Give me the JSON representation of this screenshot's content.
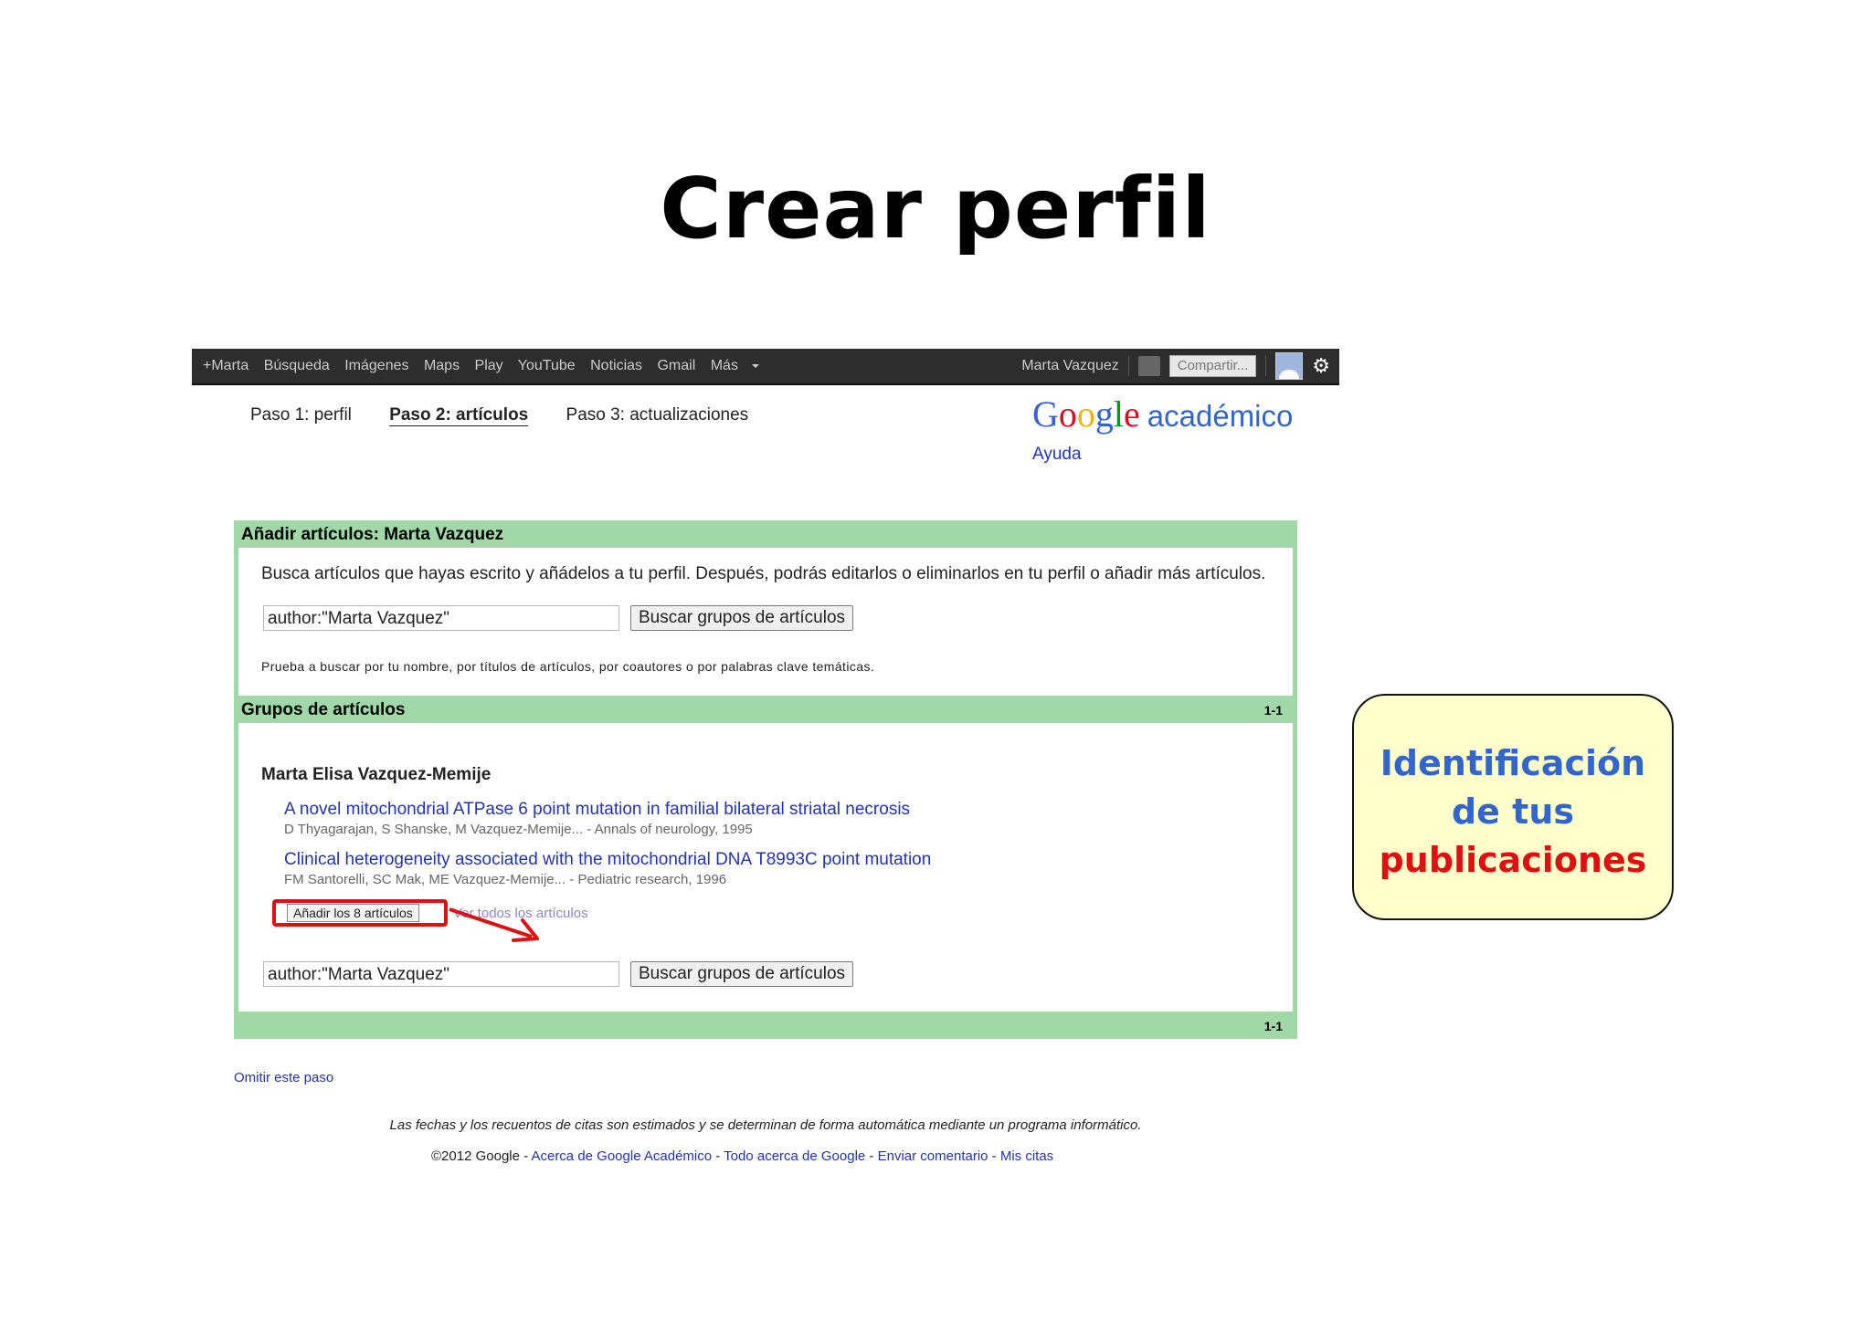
{
  "slide": {
    "title": "Crear perfil"
  },
  "gbar": {
    "links": [
      "+Marta",
      "Búsqueda",
      "Imágenes",
      "Maps",
      "Play",
      "YouTube",
      "Noticias",
      "Gmail",
      "Más"
    ],
    "user_name": "Marta Vazquez",
    "share_label": "Compartir..."
  },
  "steps": {
    "step1": "Paso 1: perfil",
    "step2": "Paso 2: artículos",
    "step3": "Paso 3: actualizaciones"
  },
  "logo": {
    "g": [
      "G",
      "o",
      "o",
      "g",
      "l",
      "e"
    ],
    "suffix": "académico"
  },
  "help_label": "Ayuda",
  "add_section": {
    "heading": "Añadir artículos: Marta Vazquez",
    "description": "Busca artículos que hayas escrito y añádelos a tu perfil. Después, podrás editarlos o eliminarlos en tu perfil o añadir más artículos.",
    "search_value": "author:\"Marta Vazquez\"",
    "search_button": "Buscar grupos de artículos",
    "hint": "Prueba a buscar por tu nombre, por títulos de artículos, por coautores o por palabras clave temáticas."
  },
  "groups_section": {
    "heading": "Grupos de artículos",
    "count": "1-1",
    "author": "Marta Elisa Vazquez-Memije",
    "articles": [
      {
        "title": "A novel mitochondrial ATPase 6 point mutation in familial bilateral striatal necrosis",
        "meta": "D Thyagarajan, S Shanske, M Vazquez-Memije... - Annals of neurology, 1995"
      },
      {
        "title": "Clinical heterogeneity associated with the mitochondrial DNA T8993C point mutation",
        "meta": "FM Santorelli, SC Mak, ME Vazquez-Memije... - Pediatric research, 1996"
      }
    ],
    "add_all_button": "Añadir los 8 artículos",
    "see_all_link": "Ver todos los artículos",
    "search_value": "author:\"Marta Vazquez\"",
    "search_button": "Buscar grupos de artículos",
    "footer_count": "1-1"
  },
  "skip_link": "Omitir este paso",
  "disclaimer": "Las fechas y los recuentos de citas son estimados y se determinan de forma automática mediante un programa informático.",
  "footer": {
    "copyright": "©2012 Google - ",
    "links": [
      "Acerca de Google Académico",
      "Todo acerca de Google",
      "Enviar comentario",
      "Mis citas"
    ],
    "separator": " - "
  },
  "callout": {
    "line1": "Identificación",
    "line2": "de tus",
    "line3": "publicaciones"
  },
  "colors": {
    "band": "#a0d8a8",
    "link": "#2233bb",
    "callout_bg": "#ffffcc",
    "callout_blue": "#3366cc",
    "callout_red": "#e01010",
    "highlight": "#e01010"
  }
}
